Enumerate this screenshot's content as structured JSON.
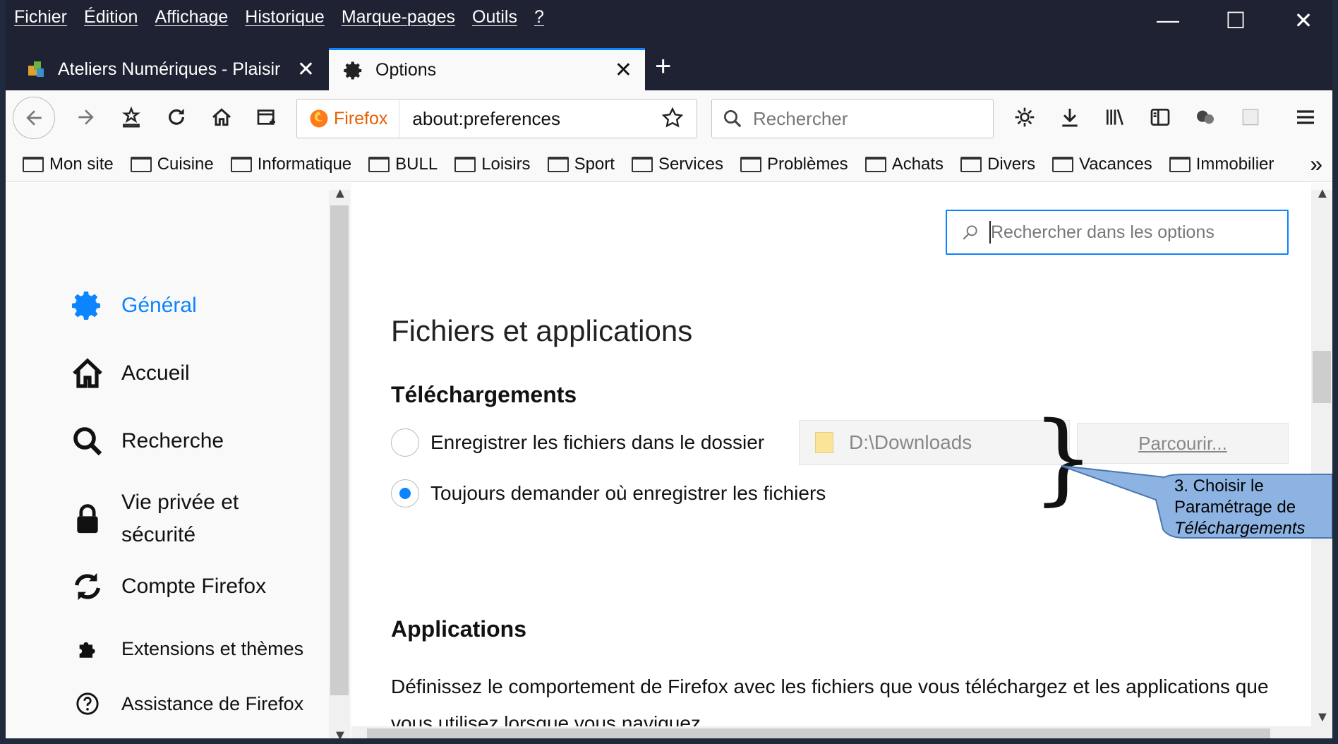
{
  "menu": [
    "Fichier",
    "Édition",
    "Affichage",
    "Historique",
    "Marque-pages",
    "Outils",
    "?"
  ],
  "window_controls": {
    "minimize": "—",
    "maximize": "☐",
    "close": "✕"
  },
  "tabs": [
    {
      "label": "Ateliers Numériques - Plaisir",
      "active": false
    },
    {
      "label": "Options",
      "active": true
    }
  ],
  "new_tab_label": "+",
  "urlbar": {
    "badge": "Firefox",
    "url": "about:preferences"
  },
  "searchbar": {
    "placeholder": "Rechercher"
  },
  "bookmarks": [
    "Mon site",
    "Cuisine",
    "Informatique",
    "BULL",
    "Loisirs",
    "Sport",
    "Services",
    "Problèmes",
    "Achats",
    "Divers",
    "Vacances",
    "Immobilier"
  ],
  "bookmarks_more": "»",
  "sidebar": {
    "items": [
      {
        "label": "Général",
        "icon": "gear-icon",
        "active": true
      },
      {
        "label": "Accueil",
        "icon": "home-icon"
      },
      {
        "label": "Recherche",
        "icon": "search-icon"
      },
      {
        "label": "Vie privée et sécurité",
        "icon": "lock-icon"
      },
      {
        "label": "Compte Firefox",
        "icon": "sync-icon"
      },
      {
        "label": "Extensions et thèmes",
        "icon": "puzzle-icon"
      },
      {
        "label": "Assistance de Firefox",
        "icon": "help-icon"
      }
    ]
  },
  "options_search": {
    "placeholder": "Rechercher dans les options"
  },
  "section_title": "Fichiers et applications",
  "downloads": {
    "heading": "Téléchargements",
    "option1": "Enregistrer les fichiers dans le dossier",
    "option2": "Toujours demander où enregistrer les fichiers",
    "selected": "option2",
    "folder": "D:\\Downloads",
    "browse": "Parcourir..."
  },
  "applications": {
    "heading": "Applications",
    "description": "Définissez le comportement de Firefox avec les fichiers que vous téléchargez et les applications que vous utilisez lorsque vous naviguez"
  },
  "callout": {
    "line1": "3. Choisir le",
    "line2": "Paramétrage de",
    "line3": "Téléchargements"
  },
  "colors": {
    "accent": "#0a84ff",
    "titlebar": "#1f2233",
    "callout": "#8db3e2"
  }
}
